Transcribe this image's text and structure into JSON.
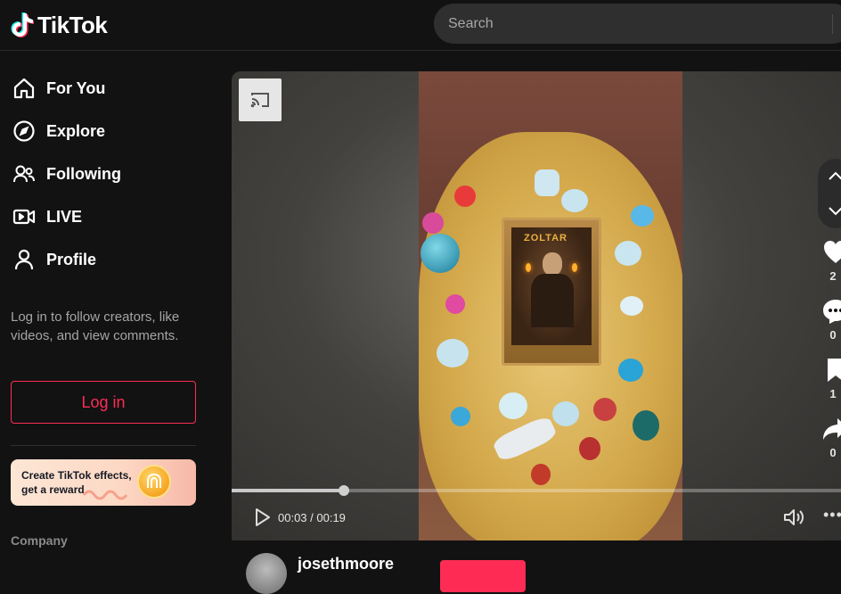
{
  "header": {
    "logo_text": "TikTok",
    "search_placeholder": "Search"
  },
  "sidebar": {
    "items": [
      {
        "label": "For You",
        "icon": "home-icon"
      },
      {
        "label": "Explore",
        "icon": "compass-icon"
      },
      {
        "label": "Following",
        "icon": "users-icon"
      },
      {
        "label": "LIVE",
        "icon": "live-icon"
      },
      {
        "label": "Profile",
        "icon": "profile-icon"
      }
    ],
    "login_hint": "Log in to follow creators, like videos, and view comments.",
    "login_button": "Log in",
    "effects_banner": "Create TikTok effects, get a reward",
    "company_label": "Company"
  },
  "video": {
    "card_title": "ZOLTAR",
    "current_time": "00:03",
    "duration": "00:19",
    "time_display": "00:03 / 00:19",
    "progress_fraction": 0.18
  },
  "actions": {
    "likes": "2",
    "comments": "0",
    "saves": "1",
    "shares": "0"
  },
  "author": {
    "username": "josethmoore"
  },
  "colors": {
    "accent": "#fe2c55",
    "background": "#121212"
  }
}
